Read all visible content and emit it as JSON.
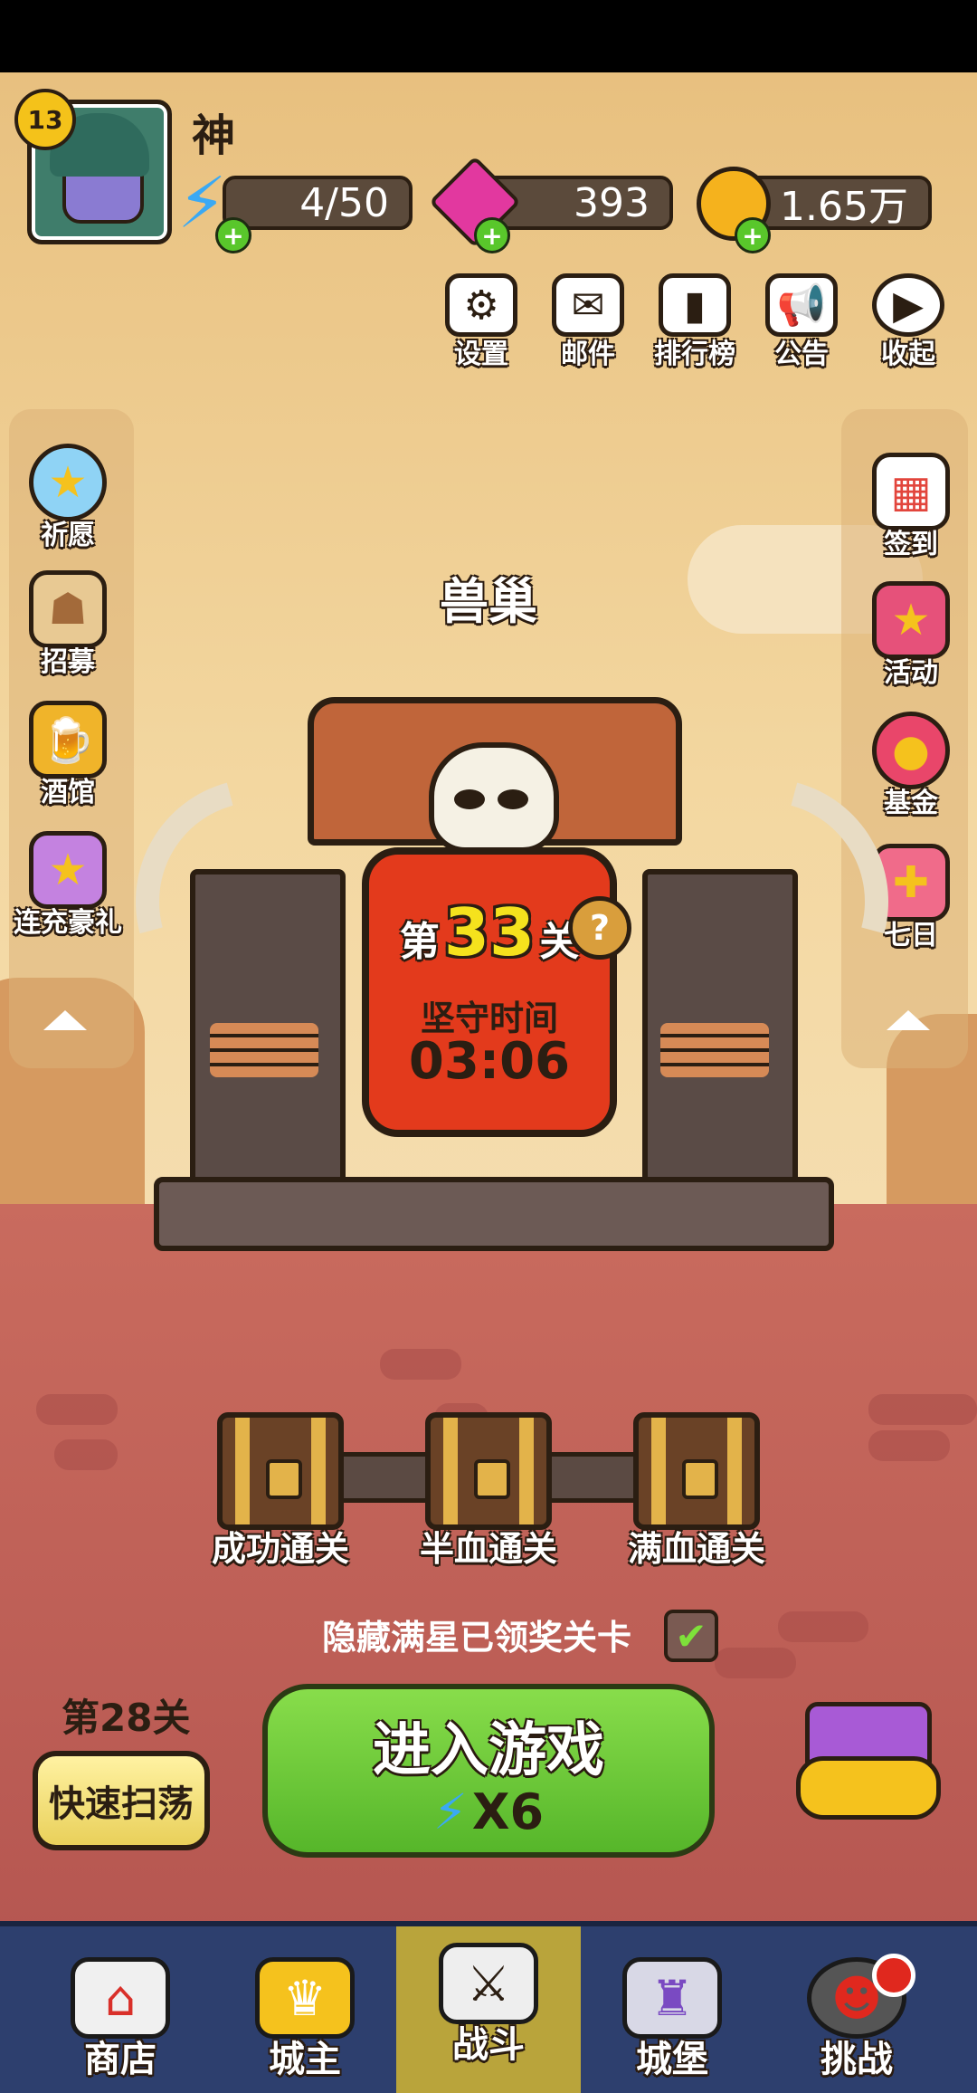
{
  "player": {
    "name": "神",
    "level": "13"
  },
  "resources": {
    "energy": "4/50",
    "gems": "393",
    "gold": "1.65万"
  },
  "top_menu": [
    {
      "label": "设置",
      "icon": "gear-icon"
    },
    {
      "label": "邮件",
      "icon": "mail-icon"
    },
    {
      "label": "排行榜",
      "icon": "leaderboard-icon"
    },
    {
      "label": "公告",
      "icon": "megaphone-icon"
    },
    {
      "label": "收起",
      "icon": "play-icon"
    }
  ],
  "left_menu": [
    {
      "label": "祈愿",
      "icon": "star-orb-icon"
    },
    {
      "label": "招募",
      "icon": "scroll-icon"
    },
    {
      "label": "酒馆",
      "icon": "beer-mug-icon"
    },
    {
      "label": "连充豪礼",
      "icon": "gift-star-icon"
    }
  ],
  "right_menu": [
    {
      "label": "签到",
      "icon": "calendar-icon"
    },
    {
      "label": "活动",
      "icon": "gift-box-icon"
    },
    {
      "label": "基金",
      "icon": "money-bag-icon"
    },
    {
      "label": "七日",
      "icon": "present-icon"
    }
  ],
  "stage": {
    "title": "兽巢",
    "level_prefix": "第",
    "level_number": "33",
    "level_suffix": "关",
    "time_label": "坚守时间",
    "time_value": "03:06"
  },
  "chests": [
    "成功通关",
    "半血通关",
    "满血通关"
  ],
  "hide_option": {
    "label": "隐藏满星已领奖关卡",
    "checked": true
  },
  "sweep": {
    "level_label": "第28关",
    "button_label": "快速扫荡"
  },
  "enter_button": {
    "label": "进入游戏",
    "cost": "X6"
  },
  "bottom_nav": [
    {
      "label": "商店",
      "icon": "shop-icon"
    },
    {
      "label": "城主",
      "icon": "crown-icon"
    },
    {
      "label": "战斗",
      "icon": "crossed-swords-icon",
      "active": true
    },
    {
      "label": "城堡",
      "icon": "castle-icon"
    },
    {
      "label": "挑战",
      "icon": "demon-icon",
      "badge": true
    }
  ],
  "colors": {
    "accent_green": "#56b62a",
    "banner_red": "#e33a1c",
    "nav_bg": "#2d3f6e",
    "active_tab": "#b9a43b"
  }
}
